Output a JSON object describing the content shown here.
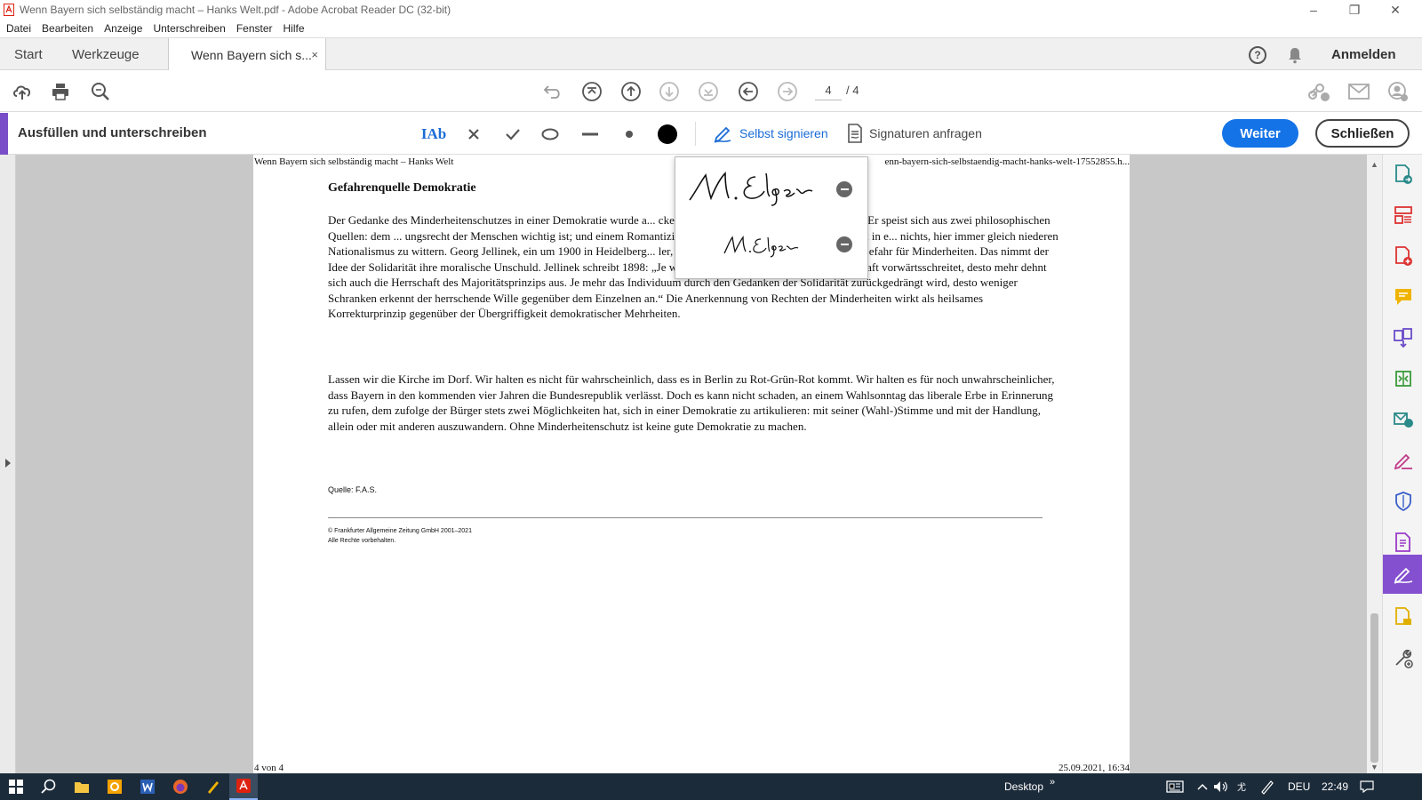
{
  "window": {
    "title": "Wenn Bayern sich selbständig macht – Hanks Welt.pdf - Adobe Acrobat Reader DC (32-bit)"
  },
  "menu": [
    "Datei",
    "Bearbeiten",
    "Anzeige",
    "Unterschreiben",
    "Fenster",
    "Hilfe"
  ],
  "tabs": {
    "start": "Start",
    "werkzeuge": "Werkzeuge",
    "document": "Wenn Bayern sich s...",
    "close": "×",
    "help": "?",
    "signin": "Anmelden"
  },
  "toolbar": {
    "page_current": "4",
    "page_total": "/ 4"
  },
  "fillsign": {
    "title": "Ausfüllen und unterschreiben",
    "text_tool": "IAb",
    "self_sign": "Selbst signieren",
    "request_signatures": "Signaturen anfragen",
    "weiter": "Weiter",
    "schliessen": "Schließen",
    "colors": {
      "accent": "#7a4dc8",
      "primary_button": "#1473e6",
      "link": "#1a6cd6"
    }
  },
  "document": {
    "header_left": "Wenn Bayern sich selbständig macht – Hanks Welt",
    "header_right": "enn-bayern-sich-selbstaendig-macht-hanks-welt-17552855.h...",
    "heading": "Gefahrenquelle Demokratie",
    "para1": "Der Gedanke des Minderheitenschutzes in einer Demokratie wurde a... ckelt, der Zeit des kolonialen Imperialismus. Er speist sich aus zwei philosophischen Quellen: dem ... ungsrecht der Menschen wichtig ist; und einem Romantizismus, der den organischen Zusammenhalt in e... nichts, hier immer gleich niederen Nationalismus zu wittern. Georg Jellinek, ein um 1900 in Heidelberg... ler, ist der Ansicht, die Demokratie sei eine Gefahr für Minderheiten. Das nimmt der Idee der Solidarität ihre moralische Unschuld. Jellinek schreibt 1898: „Je weiter die Demokratisierung der Gesellschaft vorwärtsschreitet, desto mehr dehnt sich auch die Herrschaft des Majoritätsprinzips aus. Je mehr das Individuum durch den Gedanken der Solidarität zurückgedrängt wird, desto weniger Schranken erkennt der herrschende Wille gegenüber dem Einzelnen an.“ Die Anerkennung von Rechten der Minderheiten wirkt als heilsames Korrekturprinzip gegenüber der Übergriffigkeit demokratischer Mehrheiten.",
    "para2": "Lassen wir die Kirche im Dorf. Wir halten es nicht für wahrscheinlich, dass es in Berlin zu Rot-Grün-Rot kommt. Wir halten es für noch unwahrscheinlicher, dass Bayern in den kommenden vier Jahren die Bundesrepublik verlässt. Doch es kann nicht schaden, an einem Wahlsonntag das liberale Erbe in Erinnerung zu rufen, dem zufolge der Bürger stets zwei Möglichkeiten hat, sich in einer Demokratie zu artikulieren: mit seiner (Wahl-)Stimme und mit der Handlung, allein oder mit anderen auszuwandern. Ohne Minderheitenschutz ist keine gute Demokratie zu machen.",
    "source": "Quelle: F.A.S.",
    "copyright_1": "© Frankfurter Allgemeine Zeitung GmbH 2001–2021",
    "copyright_2": "Alle Rechte vorbehalten.",
    "footer_left": "4 von 4",
    "footer_right": "25.09.2021, 16:34"
  },
  "signatures": {
    "full": "M. Elger",
    "initials": "M. Elger"
  },
  "taskbar": {
    "desktop": "Desktop",
    "lang": "DEU",
    "time": "22:49",
    "bg": "#1c2b3a"
  },
  "icons": {
    "toolbar": [
      "upload-icon",
      "print-icon",
      "zoom-icon",
      "undo-icon",
      "first-page-icon",
      "prev-page-icon",
      "next-page-icon",
      "last-page-icon",
      "back-icon",
      "forward-icon",
      "share-link-icon",
      "mail-icon",
      "account-icon"
    ],
    "right_panel": [
      "export-pdf-icon",
      "organize-pages-icon",
      "create-pdf-icon",
      "comment-icon",
      "combine-icon",
      "compress-icon",
      "send-icon",
      "fill-sign-icon",
      "protect-icon",
      "edit-pdf-icon",
      "sign-icon",
      "request-icon",
      "more-tools-icon"
    ]
  }
}
